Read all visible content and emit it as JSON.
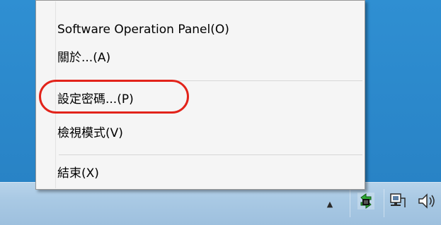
{
  "context_menu": {
    "items": [
      {
        "label": "Software Operation Panel(O)"
      },
      {
        "label": "關於...(A)"
      },
      {
        "label": "設定密碼...(P)"
      },
      {
        "label": "檢視模式(V)"
      },
      {
        "label": "結束(X)"
      }
    ]
  },
  "taskbar": {
    "tray_icons": [
      "show-hidden-icons-chevron",
      "scanner-app-icon",
      "network-icon",
      "volume-icon"
    ]
  },
  "colors": {
    "highlight": "#e2231a",
    "menu_background": "#f5f5f5",
    "desktop": "#2a86c9",
    "taskbar": "#a9c9e4"
  }
}
